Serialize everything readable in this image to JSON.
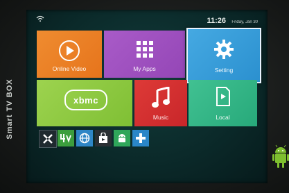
{
  "device": {
    "brand": "Smart TV BOX"
  },
  "status": {
    "time": "11:26",
    "date": "Friday, Jan 30"
  },
  "tiles": [
    {
      "label": "Online Video",
      "icon": "play-icon",
      "color": "#ec8428"
    },
    {
      "label": "My Apps",
      "icon": "app-grid-icon",
      "color": "#a352c2"
    },
    {
      "label": "Setting",
      "icon": "gear-icon",
      "color": "#3aa0dc"
    },
    {
      "label": "",
      "icon": "xbmc-logo",
      "color": "#8fca40"
    },
    {
      "label": "Music",
      "icon": "music-note-icon",
      "color": "#d43031"
    },
    {
      "label": "Local",
      "icon": "local-file-icon",
      "color": "#33b688"
    }
  ],
  "xbmc": {
    "logo_text": "XBMC"
  },
  "dock": [
    {
      "icon": "tools-icon",
      "color": "#1f2a2f"
    },
    {
      "icon": "media-4k-icon",
      "color": "#3c9e3d"
    },
    {
      "icon": "browser-globe-icon",
      "color": "#2f86c6"
    },
    {
      "icon": "shop-bag-icon",
      "color": "#2a2f33"
    },
    {
      "icon": "android-app-icon",
      "color": "#2fa65a"
    },
    {
      "icon": "add-icon",
      "color": "#2a86c8"
    }
  ]
}
